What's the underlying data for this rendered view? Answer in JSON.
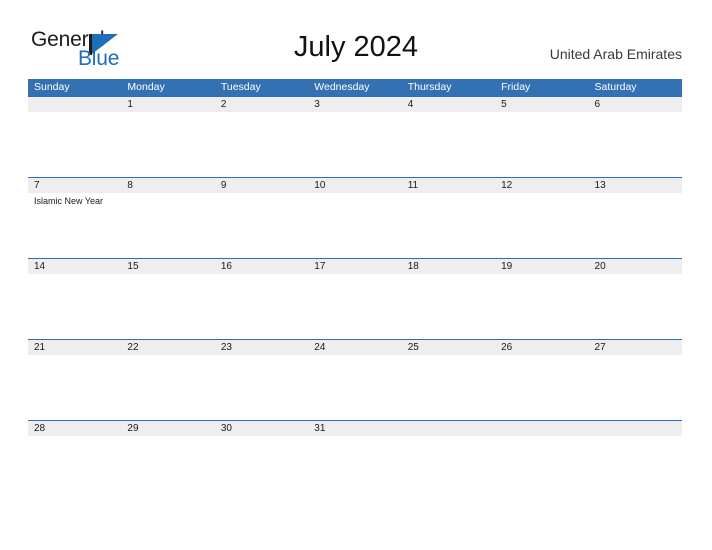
{
  "brand": {
    "name_part1": "General",
    "name_part2": "Blue",
    "flag_icon": "flag-triangle-icon",
    "color_dark": "#1c1c1c",
    "color_blue": "#1f6fb8"
  },
  "header": {
    "title": "July 2024",
    "region": "United Arab Emirates"
  },
  "theme": {
    "header_blue": "#3371b3",
    "row_rule_blue": "#2f6eb5",
    "band_gray": "#eeeeee",
    "page_background": "#ffffff"
  },
  "calendar": {
    "month": "July",
    "year": "2024",
    "weekday_headers": [
      "Sunday",
      "Monday",
      "Tuesday",
      "Wednesday",
      "Thursday",
      "Friday",
      "Saturday"
    ],
    "weeks": [
      {
        "days": [
          {
            "num": "",
            "events": []
          },
          {
            "num": "1",
            "events": []
          },
          {
            "num": "2",
            "events": []
          },
          {
            "num": "3",
            "events": []
          },
          {
            "num": "4",
            "events": []
          },
          {
            "num": "5",
            "events": []
          },
          {
            "num": "6",
            "events": []
          }
        ]
      },
      {
        "days": [
          {
            "num": "7",
            "events": [
              "Islamic New Year"
            ]
          },
          {
            "num": "8",
            "events": []
          },
          {
            "num": "9",
            "events": []
          },
          {
            "num": "10",
            "events": []
          },
          {
            "num": "11",
            "events": []
          },
          {
            "num": "12",
            "events": []
          },
          {
            "num": "13",
            "events": []
          }
        ]
      },
      {
        "days": [
          {
            "num": "14",
            "events": []
          },
          {
            "num": "15",
            "events": []
          },
          {
            "num": "16",
            "events": []
          },
          {
            "num": "17",
            "events": []
          },
          {
            "num": "18",
            "events": []
          },
          {
            "num": "19",
            "events": []
          },
          {
            "num": "20",
            "events": []
          }
        ]
      },
      {
        "days": [
          {
            "num": "21",
            "events": []
          },
          {
            "num": "22",
            "events": []
          },
          {
            "num": "23",
            "events": []
          },
          {
            "num": "24",
            "events": []
          },
          {
            "num": "25",
            "events": []
          },
          {
            "num": "26",
            "events": []
          },
          {
            "num": "27",
            "events": []
          }
        ]
      },
      {
        "days": [
          {
            "num": "28",
            "events": []
          },
          {
            "num": "29",
            "events": []
          },
          {
            "num": "30",
            "events": []
          },
          {
            "num": "31",
            "events": []
          },
          {
            "num": "",
            "events": []
          },
          {
            "num": "",
            "events": []
          },
          {
            "num": "",
            "events": []
          }
        ]
      }
    ]
  }
}
